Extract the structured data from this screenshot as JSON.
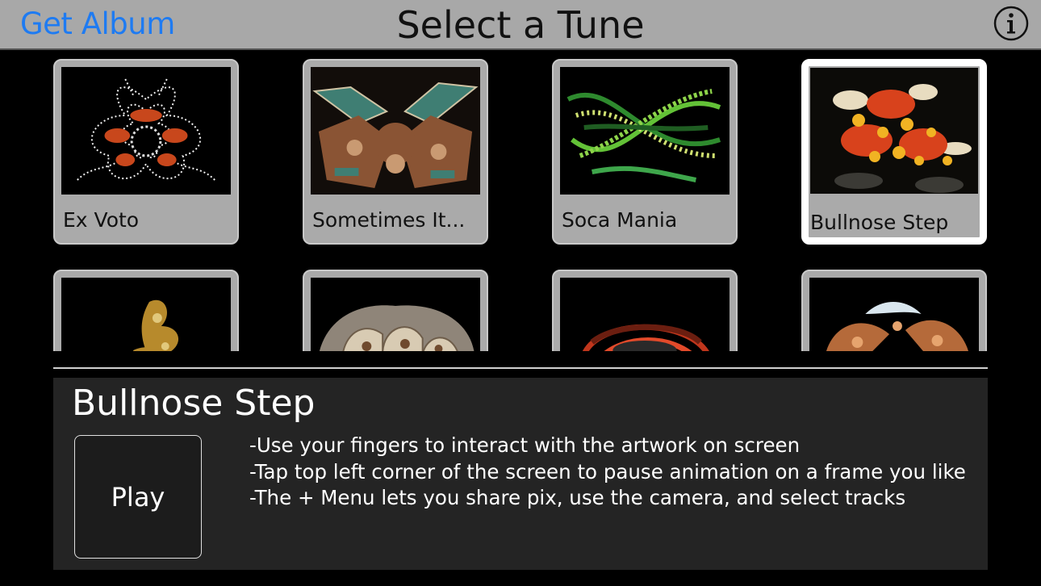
{
  "header": {
    "left_button": "Get Album",
    "title": "Select a Tune",
    "info_icon": "info-icon"
  },
  "tunes": [
    {
      "label": "Ex Voto",
      "selected": false
    },
    {
      "label": "Sometimes It...",
      "selected": false
    },
    {
      "label": "Soca Mania",
      "selected": false
    },
    {
      "label": "Bullnose Step",
      "selected": true
    },
    {
      "label": "",
      "selected": false
    },
    {
      "label": "",
      "selected": false
    },
    {
      "label": "",
      "selected": false
    },
    {
      "label": "",
      "selected": false
    }
  ],
  "detail": {
    "title": "Bullnose Step",
    "play_label": "Play",
    "instructions": [
      "-Use your fingers to interact with the artwork on screen",
      "-Tap top left corner of the screen to pause animation on a frame you like",
      "-The + Menu lets you share pix, use the camera, and select tracks"
    ]
  },
  "colors": {
    "header_bg": "#a8a8a8",
    "link": "#1e7bf2",
    "panel_bg": "#242424"
  }
}
